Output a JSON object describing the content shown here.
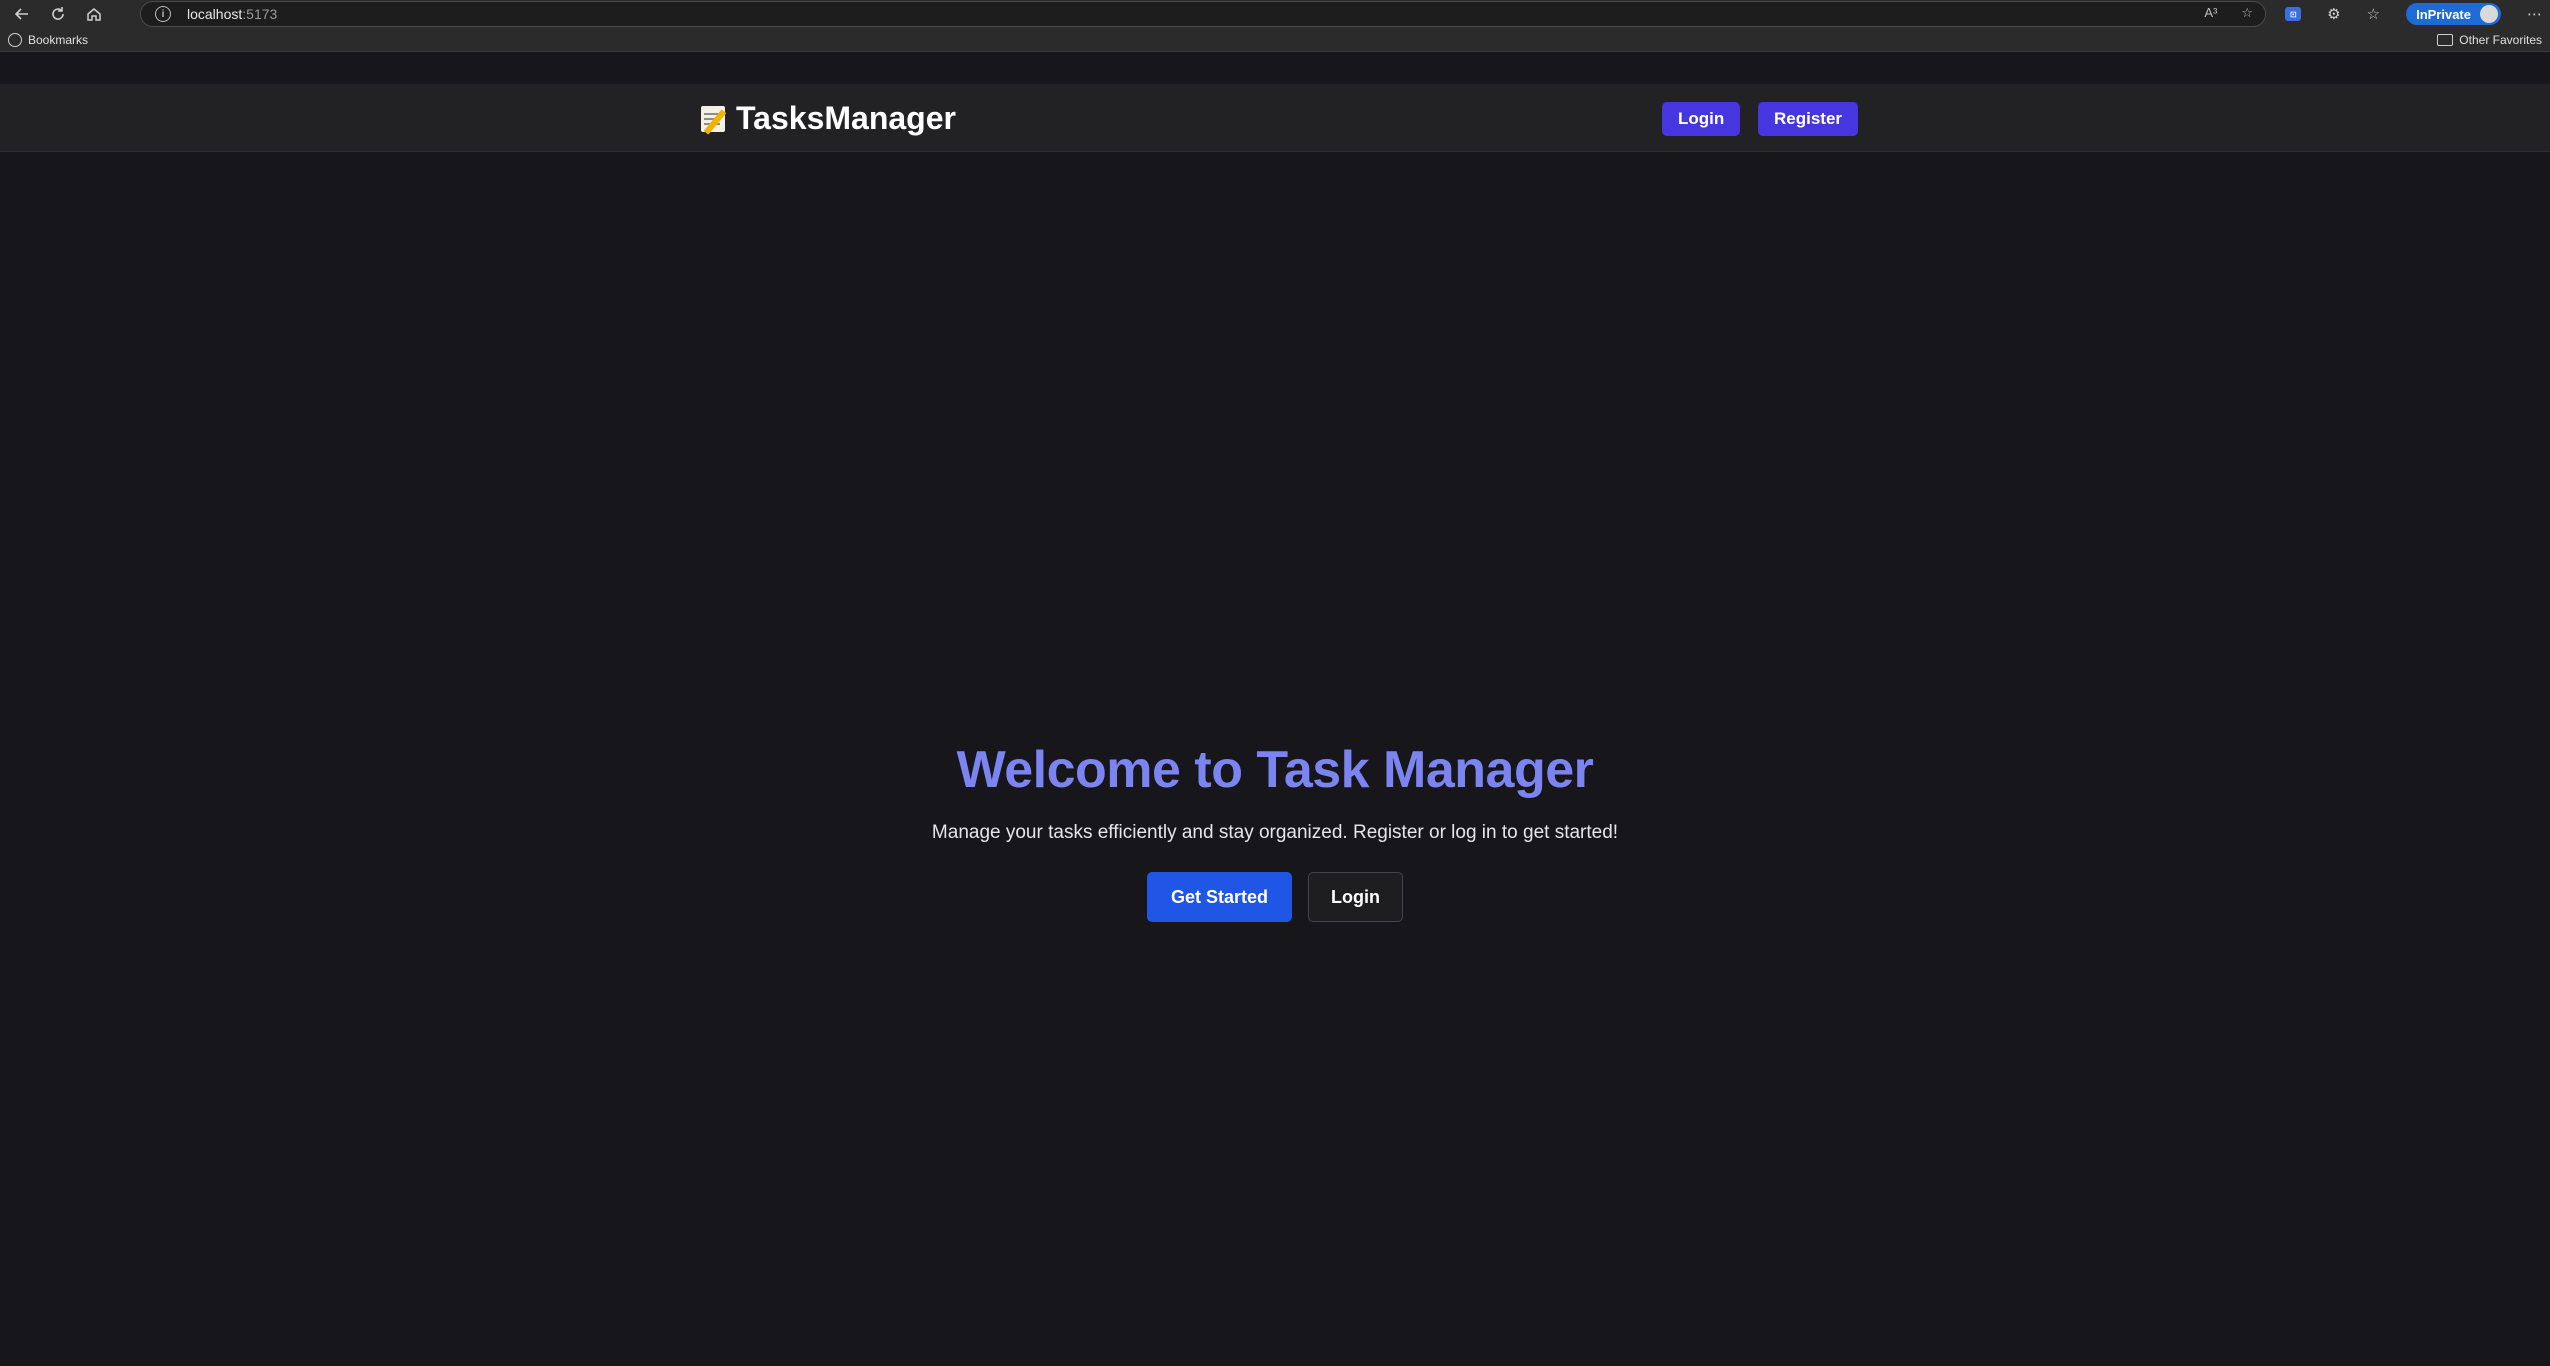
{
  "browser": {
    "url_host": "localhost",
    "url_port": ":5173",
    "inprivate_label": "InPrivate",
    "bookmarks_label": "Bookmarks",
    "other_favorites_label": "Other Favorites",
    "read_aloud_label": "A³"
  },
  "app": {
    "brand": "TasksManager",
    "header_login": "Login",
    "header_register": "Register",
    "hero_title": "Welcome to Task Manager",
    "hero_subtitle": "Manage your tasks efficiently and stay organized. Register or log in to get started!",
    "get_started_label": "Get Started",
    "login_label": "Login"
  },
  "colors": {
    "page_bg": "#16161b",
    "header_bg": "#222225",
    "accent_purple": "#4536e0",
    "title_color": "#7b84f0",
    "primary_blue": "#1f56e6"
  }
}
